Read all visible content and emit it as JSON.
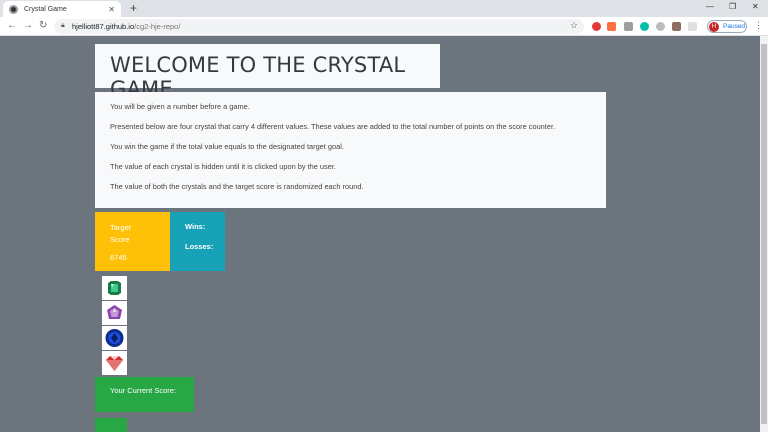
{
  "browser": {
    "tab_title": "Crystal Game",
    "new_tab": "+",
    "url_host": "hjelliott87.github.io",
    "url_path": "/cg2-hje-repo/",
    "profile_initial": "H",
    "profile_status": "Paused"
  },
  "page": {
    "title": "WELCOME TO THE CRYSTAL GAME",
    "instructions": [
      "You will be given a number before a game.",
      "Presented below are four crystal that carry 4 different values. These values are added to the total number of points on the score counter.",
      "You win the game if the total value equals to the designated target goal.",
      "The value of each crystal is hidden until it is clicked upon by the user.",
      "The value of both the crystals and the target score is randomized each round."
    ],
    "target_label": "Target Score",
    "target_value": "6745",
    "wins_label": "Wins:",
    "losses_label": "Losses:",
    "current_score_label": "Your Current Score:"
  },
  "colors": {
    "background": "#6c757d",
    "target": "#ffc107",
    "stats": "#17a2b8",
    "score": "#28a745"
  },
  "crystals": [
    "green-emerald-crystal",
    "purple-amethyst-crystal",
    "blue-sapphire-crystal",
    "red-ruby-crystal"
  ]
}
